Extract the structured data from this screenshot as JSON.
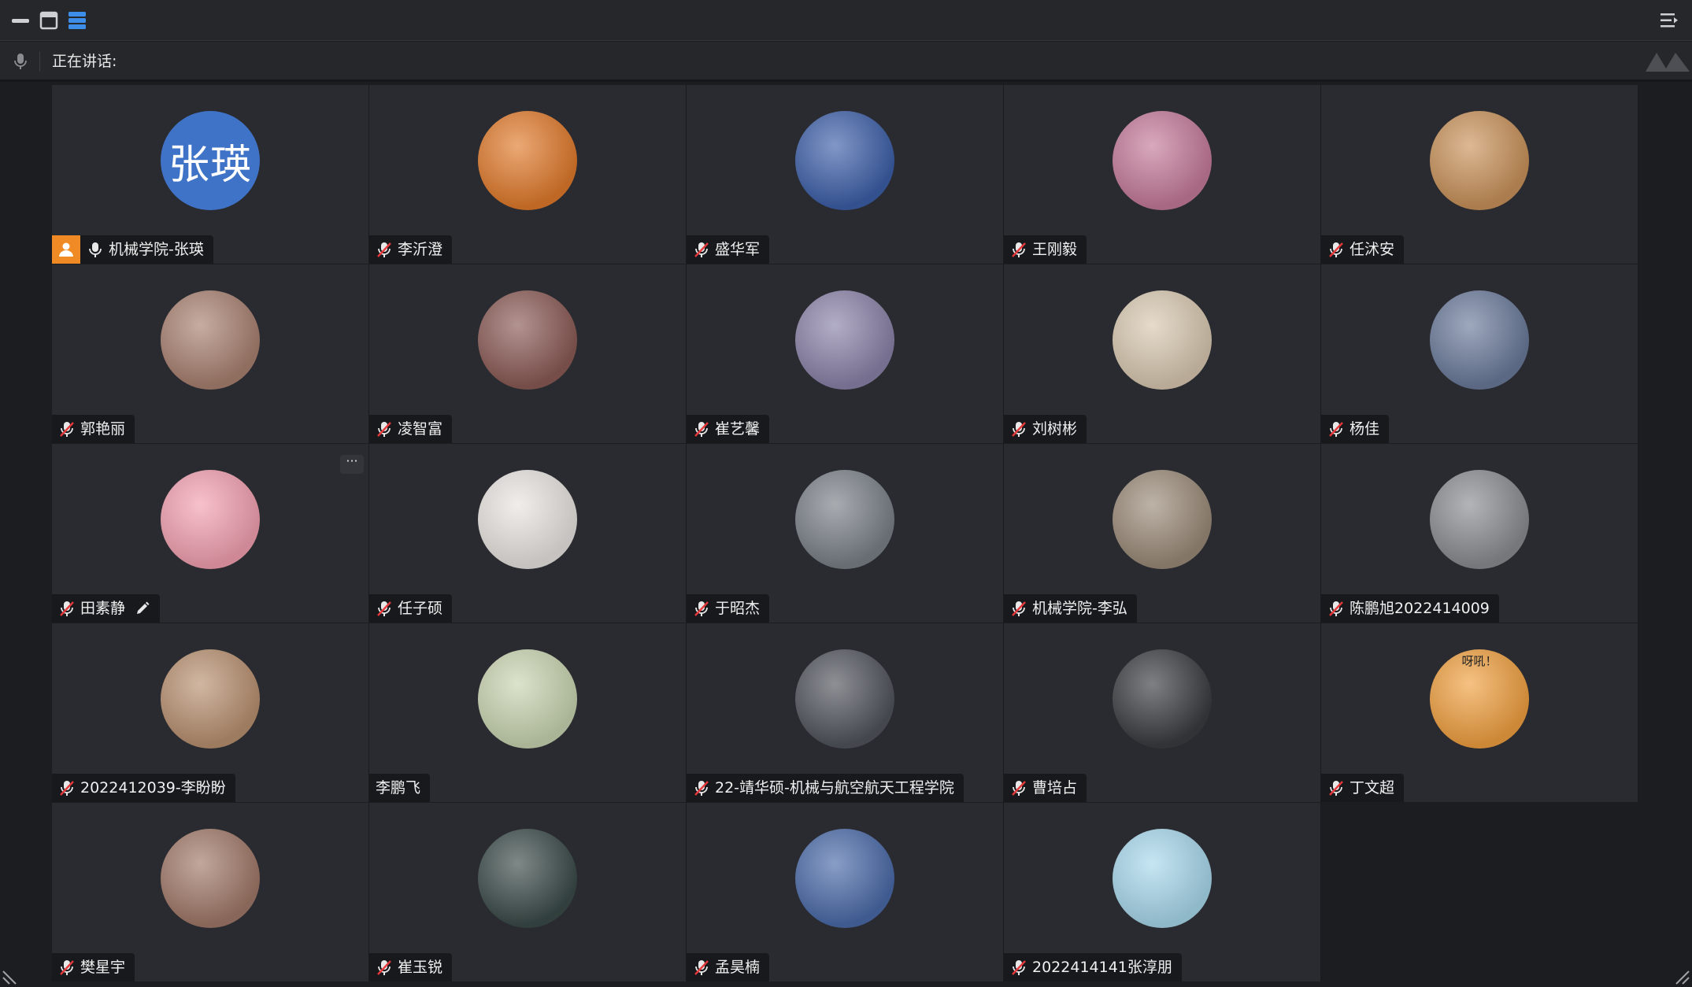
{
  "speaking_bar": {
    "label": "正在讲话:"
  },
  "host_avatar_text": "张瑛",
  "more_button": "···",
  "participants": [
    {
      "name": "机械学院-张瑛",
      "mic": "on",
      "host": true,
      "avatar": "text",
      "color": "#3f73c7"
    },
    {
      "name": "李沂澄",
      "mic": "muted",
      "avatar": "photo",
      "color": "#e07a2b"
    },
    {
      "name": "盛华军",
      "mic": "muted",
      "avatar": "photo",
      "color": "#3d5fa8"
    },
    {
      "name": "王刚毅",
      "mic": "muted",
      "avatar": "photo",
      "color": "#c47a9a"
    },
    {
      "name": "任沭安",
      "mic": "muted",
      "avatar": "photo",
      "color": "#c9925a"
    },
    {
      "name": "郭艳丽",
      "mic": "muted",
      "avatar": "photo",
      "color": "#a88070"
    },
    {
      "name": "凌智富",
      "mic": "muted",
      "avatar": "photo",
      "color": "#8a5a55"
    },
    {
      "name": "崔艺馨",
      "mic": "muted",
      "avatar": "photo",
      "color": "#8a82a8"
    },
    {
      "name": "刘树彬",
      "mic": "muted",
      "avatar": "photo",
      "color": "#d8c8b0"
    },
    {
      "name": "杨佳",
      "mic": "muted",
      "avatar": "photo",
      "color": "#6a7a9a"
    },
    {
      "name": "田素静",
      "mic": "muted",
      "avatar": "photo",
      "color": "#f2a0b0",
      "editable": true,
      "more": true
    },
    {
      "name": "任子硕",
      "mic": "muted",
      "avatar": "photo",
      "color": "#e8e4e0"
    },
    {
      "name": "于昭杰",
      "mic": "muted",
      "avatar": "photo",
      "color": "#7a8088"
    },
    {
      "name": "机械学院-李弘",
      "mic": "muted",
      "avatar": "photo",
      "color": "#9a8a78"
    },
    {
      "name": "陈鹏旭2022414009",
      "mic": "muted",
      "avatar": "photo",
      "color": "#8a8c90"
    },
    {
      "name": "2022412039-李盼盼",
      "mic": "muted",
      "avatar": "photo",
      "color": "#b89070"
    },
    {
      "name": "李鹏飞",
      "mic": "none",
      "avatar": "photo",
      "color": "#c8d4b0"
    },
    {
      "name": "22-靖华硕-机械与航空航天工程学院",
      "mic": "muted",
      "avatar": "photo",
      "color": "#50545c"
    },
    {
      "name": "曹培占",
      "mic": "muted",
      "avatar": "photo",
      "color": "#3a3c40"
    },
    {
      "name": "丁文超",
      "mic": "muted",
      "avatar": "photo",
      "color": "#f0a040",
      "caption": "呀吼！"
    },
    {
      "name": "樊星宇",
      "mic": "muted",
      "avatar": "photo",
      "color": "#a07868"
    },
    {
      "name": "崔玉锐",
      "mic": "muted",
      "avatar": "photo",
      "color": "#3a4a48"
    },
    {
      "name": "孟昊楠",
      "mic": "muted",
      "avatar": "photo",
      "color": "#4a6aa8"
    },
    {
      "name": "2022414141张淳朋",
      "mic": "muted",
      "avatar": "photo",
      "color": "#a8d8ec"
    }
  ]
}
